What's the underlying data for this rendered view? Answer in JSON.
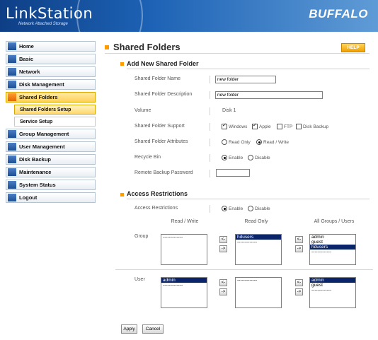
{
  "header": {
    "logo": "LinkStation",
    "logo_sub": "Network Attached Storage",
    "brand": "BUFFALO"
  },
  "sidebar": {
    "items": [
      {
        "label": "Home",
        "icon": "home-icon"
      },
      {
        "label": "Basic",
        "icon": "basic-icon"
      },
      {
        "label": "Network",
        "icon": "network-icon"
      },
      {
        "label": "Disk Management",
        "icon": "disk-icon"
      },
      {
        "label": "Shared Folders",
        "icon": "folder-icon",
        "active": true
      },
      {
        "label": "Group Management",
        "icon": "group-icon"
      },
      {
        "label": "User Management",
        "icon": "user-icon"
      },
      {
        "label": "Disk Backup",
        "icon": "backup-icon"
      },
      {
        "label": "Maintenance",
        "icon": "maintenance-icon"
      },
      {
        "label": "System Status",
        "icon": "status-icon"
      },
      {
        "label": "Logout",
        "icon": "logout-icon"
      }
    ],
    "subitems": [
      {
        "label": "Shared Folders Setup",
        "active": true
      },
      {
        "label": "Service Setup"
      }
    ]
  },
  "page": {
    "title": "Shared Folders",
    "help": "HELP"
  },
  "add_folder": {
    "title": "Add New Shared Folder",
    "name_label": "Shared Folder Name",
    "name_value": "new folder",
    "desc_label": "Shared Folder Description",
    "desc_value": "new folder",
    "volume_label": "Volume",
    "volume_value": "Disk 1",
    "support_label": "Shared Folder Support",
    "support_options": [
      "Windows",
      "Apple",
      "FTP",
      "Disk Backup"
    ],
    "attr_label": "Shared Folder Attributes",
    "attr_options": [
      "Read Only",
      "Read / Write"
    ],
    "recycle_label": "Recycle Bin",
    "recycle_options": [
      "Enable",
      "Disable"
    ],
    "remote_label": "Remote Backup Password",
    "remote_value": ""
  },
  "access": {
    "title": "Access Restrictions",
    "label": "Access Restrictions",
    "options": [
      "Enable",
      "Disable"
    ],
    "columns": [
      "Read / Write",
      "Read Only",
      "All Groups / Users"
    ],
    "group_label": "Group",
    "user_label": "User",
    "group_rw": [
      "-------------"
    ],
    "group_ro": [
      "hdusers",
      "-------------"
    ],
    "group_all": [
      "admin",
      "guest",
      "hdusers",
      "-------------"
    ],
    "user_rw": [
      "admin",
      "-------------"
    ],
    "user_ro": [
      "-------------"
    ],
    "user_all": [
      "admin",
      "guest",
      "-------------"
    ],
    "move_left": "<-",
    "move_right": "->"
  },
  "actions": {
    "apply": "Apply",
    "cancel": "Cancel"
  }
}
